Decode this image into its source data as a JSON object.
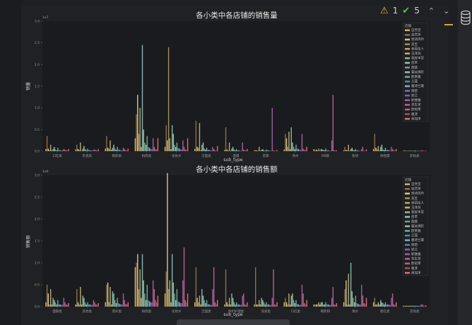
{
  "inspector": {
    "warnings": "1",
    "checks": "5"
  },
  "chart_data": [
    {
      "type": "bar",
      "title": "各小类中各店铺的销售量",
      "xlabel": "sub_type",
      "ylabel": "销量",
      "exponent": "1e7",
      "ylim": [
        0,
        3.0
      ],
      "yticks": [
        "0.0",
        "0.5",
        "1.0",
        "1.5",
        "2.0",
        "2.5",
        "3.0"
      ],
      "categories": [
        "口红类",
        "乳液类",
        "眼影类",
        "粉底类",
        "化妆水",
        "洁面类",
        "面膜",
        "唇膏",
        "香水",
        "BB霜",
        "粉饼",
        "防晒霜",
        "卸妆类"
      ],
      "legend_title": "店铺",
      "series": [
        {
          "name": "自然堂",
          "values": [
            0.05,
            0.04,
            0.06,
            0.3,
            0.1,
            0.05,
            0.03,
            0.02,
            0.04,
            0.05,
            0.02,
            0.05,
            0.01
          ]
        },
        {
          "name": "自然堂",
          "values": [
            0.35,
            0.15,
            0.35,
            0.85,
            0.6,
            0.7,
            0.55,
            0.03,
            0.4,
            0.02,
            0.1,
            0.4,
            0.02
          ]
        },
        {
          "name": "悦诗风吟",
          "values": [
            0.06,
            0.05,
            0.08,
            1.3,
            0.25,
            0.1,
            0.04,
            0.02,
            0.3,
            0.04,
            0.03,
            0.08,
            0.01
          ]
        },
        {
          "name": "美宝",
          "values": [
            0.03,
            0.03,
            0.05,
            0.4,
            2.4,
            0.08,
            0.02,
            0.01,
            0.1,
            0.02,
            0.02,
            0.04,
            0.01
          ]
        },
        {
          "name": "美丽佳人",
          "values": [
            0.15,
            0.2,
            0.25,
            1.0,
            0.3,
            0.65,
            0.2,
            0.1,
            0.45,
            0.06,
            0.15,
            0.12,
            0.01
          ]
        },
        {
          "name": "玉泽润",
          "values": [
            0.02,
            0.01,
            0.03,
            0.1,
            0.05,
            0.02,
            0.01,
            0.01,
            0.05,
            0.01,
            0.01,
            0.02,
            0.01
          ]
        },
        {
          "name": "相宜本草",
          "values": [
            0.05,
            0.06,
            0.08,
            2.45,
            0.6,
            0.15,
            0.06,
            0.03,
            0.55,
            0.05,
            0.05,
            0.1,
            0.01
          ]
        },
        {
          "name": "佰草",
          "values": [
            0.1,
            0.12,
            0.15,
            0.5,
            0.4,
            0.2,
            0.1,
            0.05,
            0.2,
            0.04,
            0.08,
            0.15,
            0.01
          ]
        },
        {
          "name": "薇薇",
          "values": [
            0.04,
            0.05,
            0.06,
            0.2,
            0.15,
            0.06,
            0.04,
            0.02,
            0.1,
            0.03,
            0.03,
            0.04,
            0.01
          ]
        },
        {
          "name": "蜜丝佛陀",
          "values": [
            0.02,
            0.02,
            0.03,
            0.15,
            0.1,
            0.04,
            0.02,
            0.01,
            0.05,
            0.02,
            0.02,
            0.03,
            0.01
          ]
        },
        {
          "name": "欧莱雅",
          "values": [
            0.08,
            0.06,
            0.1,
            0.35,
            0.2,
            0.08,
            0.05,
            0.04,
            0.15,
            0.06,
            0.05,
            0.08,
            0.02
          ]
        },
        {
          "name": "兰蔻",
          "values": [
            0.03,
            0.03,
            0.04,
            0.1,
            0.08,
            0.03,
            0.02,
            0.02,
            0.06,
            0.02,
            0.02,
            0.03,
            0.01
          ]
        },
        {
          "name": "雅诗兰黛",
          "values": [
            0.02,
            0.02,
            0.03,
            0.08,
            0.06,
            0.03,
            0.02,
            0.02,
            0.05,
            0.02,
            0.02,
            0.03,
            0.01
          ]
        },
        {
          "name": "倩碧",
          "values": [
            0.02,
            0.02,
            0.02,
            0.05,
            0.04,
            0.02,
            0.01,
            0.01,
            0.03,
            0.01,
            0.01,
            0.02,
            0.01
          ]
        },
        {
          "name": "娇兰",
          "values": [
            0.02,
            0.02,
            0.02,
            0.05,
            0.04,
            0.02,
            0.01,
            0.01,
            0.03,
            0.01,
            0.01,
            0.02,
            0.01
          ]
        },
        {
          "name": "妮维雅",
          "values": [
            0.05,
            0.03,
            0.08,
            0.3,
            0.25,
            0.1,
            0.2,
            1.0,
            0.4,
            0.25,
            0.05,
            0.1,
            0.02
          ]
        },
        {
          "name": "资生堂",
          "values": [
            0.04,
            0.04,
            0.05,
            0.1,
            0.1,
            0.05,
            0.04,
            0.02,
            0.06,
            1.3,
            0.1,
            0.05,
            0.02
          ]
        },
        {
          "name": "欧珀莱",
          "values": [
            0.02,
            0.02,
            0.02,
            0.05,
            0.04,
            0.02,
            0.02,
            0.01,
            0.03,
            0.02,
            0.01,
            0.02,
            0.01
          ]
        },
        {
          "name": "雅漾",
          "values": [
            0.02,
            0.02,
            0.02,
            0.04,
            0.03,
            0.02,
            0.02,
            0.01,
            0.03,
            0.02,
            0.01,
            0.02,
            0.01
          ]
        },
        {
          "name": "美加净",
          "values": [
            0.05,
            0.05,
            0.06,
            0.3,
            0.3,
            0.12,
            0.05,
            0.03,
            0.1,
            0.02,
            0.04,
            0.05,
            0.01
          ]
        }
      ]
    },
    {
      "type": "bar",
      "title": "各小类中各店铺的销售额",
      "xlabel": "sub_type",
      "ylabel": "销售额",
      "exponent": "1e9",
      "ylim": [
        0,
        3.0
      ],
      "yticks": [
        "0.0",
        "0.5",
        "1.0",
        "1.5",
        "2.0",
        "2.5",
        "3.0"
      ],
      "categories": [
        "面部类",
        "其他类",
        "唇彩类",
        "粉底类",
        "化妆水",
        "洁面类",
        "防护护理类",
        "洗发类",
        "口红类",
        "眼影粉",
        "香水",
        "腮红类",
        "其他类"
      ],
      "legend_title": "店铺",
      "series": [
        {
          "name": "自然堂",
          "values": [
            0.1,
            0.05,
            0.1,
            0.9,
            0.3,
            0.1,
            0.05,
            0.05,
            0.1,
            0.05,
            0.1,
            0.1,
            0.02
          ]
        },
        {
          "name": "自然堂",
          "values": [
            0.5,
            0.4,
            0.5,
            1.0,
            0.8,
            0.9,
            0.85,
            0.9,
            0.2,
            0.05,
            0.4,
            0.2,
            0.02
          ]
        },
        {
          "name": "悦诗风吟",
          "values": [
            0.3,
            0.1,
            0.55,
            1.2,
            3.05,
            0.2,
            0.1,
            0.05,
            0.1,
            0.05,
            0.6,
            0.05,
            0.02
          ]
        },
        {
          "name": "美宝",
          "values": [
            0.05,
            0.05,
            0.1,
            0.4,
            0.4,
            0.1,
            0.05,
            0.05,
            0.05,
            0.05,
            0.05,
            0.05,
            0.02
          ]
        },
        {
          "name": "美丽佳人",
          "values": [
            0.4,
            0.45,
            0.45,
            0.85,
            0.6,
            0.25,
            0.2,
            0.15,
            0.3,
            0.1,
            0.75,
            0.1,
            0.02
          ]
        },
        {
          "name": "玉泽润",
          "values": [
            0.05,
            0.05,
            0.05,
            0.2,
            0.1,
            0.05,
            0.05,
            0.05,
            0.05,
            0.05,
            0.05,
            0.05,
            0.02
          ]
        },
        {
          "name": "相宜本草",
          "values": [
            0.2,
            0.25,
            0.35,
            1.2,
            1.2,
            0.4,
            0.3,
            0.2,
            0.25,
            0.1,
            1.0,
            0.15,
            0.02
          ]
        },
        {
          "name": "佰草",
          "values": [
            0.15,
            0.2,
            0.3,
            0.6,
            0.55,
            0.25,
            0.2,
            0.15,
            0.3,
            0.1,
            0.35,
            0.1,
            0.02
          ]
        },
        {
          "name": "薇薇",
          "values": [
            0.1,
            0.1,
            0.15,
            0.3,
            0.3,
            0.15,
            0.1,
            0.1,
            0.15,
            0.05,
            0.2,
            0.08,
            0.02
          ]
        },
        {
          "name": "蜜丝佛陀",
          "values": [
            0.05,
            0.05,
            0.08,
            0.15,
            0.15,
            0.08,
            0.05,
            0.05,
            0.08,
            0.05,
            0.1,
            0.05,
            0.02
          ]
        },
        {
          "name": "欧莱雅",
          "values": [
            0.15,
            0.1,
            0.2,
            0.5,
            0.4,
            0.15,
            0.1,
            0.1,
            0.15,
            0.1,
            0.25,
            0.1,
            0.02
          ]
        },
        {
          "name": "兰蔻",
          "values": [
            0.05,
            0.05,
            0.08,
            0.15,
            0.12,
            0.06,
            0.05,
            0.05,
            0.06,
            0.05,
            0.08,
            0.05,
            0.02
          ]
        },
        {
          "name": "雅诗兰黛",
          "values": [
            0.05,
            0.05,
            0.06,
            0.12,
            0.1,
            0.05,
            0.05,
            0.05,
            0.05,
            0.05,
            0.06,
            0.05,
            0.02
          ]
        },
        {
          "name": "倩碧",
          "values": [
            0.04,
            0.04,
            0.05,
            0.1,
            0.08,
            0.04,
            0.04,
            0.04,
            0.04,
            0.04,
            0.05,
            0.04,
            0.02
          ]
        },
        {
          "name": "娇兰",
          "values": [
            0.04,
            0.04,
            0.05,
            0.1,
            0.08,
            0.04,
            0.04,
            0.04,
            0.04,
            0.04,
            0.05,
            0.04,
            0.02
          ]
        },
        {
          "name": "妮维雅",
          "values": [
            0.2,
            0.15,
            0.3,
            0.6,
            0.6,
            0.4,
            0.25,
            0.2,
            0.5,
            0.2,
            0.5,
            0.2,
            0.05
          ]
        },
        {
          "name": "资生堂",
          "values": [
            0.1,
            0.1,
            0.15,
            0.4,
            1.35,
            0.9,
            0.3,
            0.85,
            0.3,
            0.45,
            0.25,
            0.3,
            0.05
          ]
        },
        {
          "name": "欧珀莱",
          "values": [
            0.05,
            0.05,
            0.06,
            0.15,
            0.15,
            0.1,
            0.05,
            0.05,
            0.08,
            0.05,
            0.08,
            0.05,
            0.02
          ]
        },
        {
          "name": "雅漾",
          "values": [
            0.04,
            0.04,
            0.05,
            0.1,
            0.1,
            0.06,
            0.04,
            0.04,
            0.05,
            0.04,
            0.06,
            0.04,
            0.02
          ]
        },
        {
          "name": "美加净",
          "values": [
            0.08,
            0.08,
            0.1,
            0.25,
            0.3,
            0.15,
            0.1,
            0.1,
            0.15,
            0.08,
            0.2,
            0.1,
            0.03
          ]
        }
      ]
    }
  ],
  "palette": [
    "#c9b26a",
    "#8b6e4a",
    "#cfc48a",
    "#9e8e55",
    "#b9a56e",
    "#d2a85a",
    "#7fb3b0",
    "#9cc39a",
    "#6e9d86",
    "#a3b7a8",
    "#6da7a2",
    "#4e8e92",
    "#8fa7c4",
    "#5f7fa7",
    "#7468a6",
    "#9a5fa0",
    "#b65d8c",
    "#c55f73",
    "#a04c5f",
    "#d46b7a"
  ]
}
